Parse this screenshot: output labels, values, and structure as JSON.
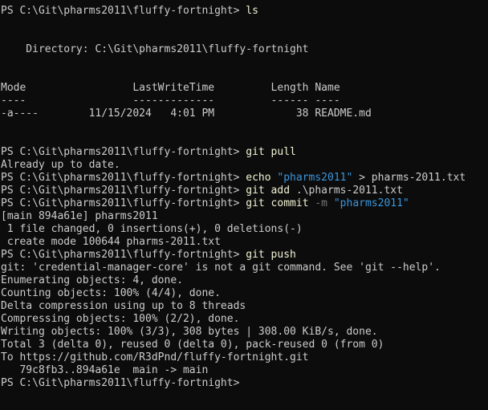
{
  "terminal": {
    "lines": [
      {
        "segments": [
          {
            "text": "PS C:\\Git\\pharms2011\\fluffy-fortnight> ",
            "class": "plain"
          },
          {
            "text": "ls",
            "class": "cmd"
          }
        ]
      },
      {
        "segments": []
      },
      {
        "segments": []
      },
      {
        "segments": [
          {
            "text": "    Directory: C:\\Git\\pharms2011\\fluffy-fortnight",
            "class": "plain"
          }
        ]
      },
      {
        "segments": []
      },
      {
        "segments": []
      },
      {
        "segments": [
          {
            "text": "Mode                 LastWriteTime         Length Name",
            "class": "plain"
          }
        ]
      },
      {
        "segments": [
          {
            "text": "----                 -------------         ------ ----",
            "class": "plain"
          }
        ]
      },
      {
        "segments": [
          {
            "text": "-a----        11/15/2024   4:01 PM             38 README.md",
            "class": "plain"
          }
        ]
      },
      {
        "segments": []
      },
      {
        "segments": []
      },
      {
        "segments": [
          {
            "text": "PS C:\\Git\\pharms2011\\fluffy-fortnight> ",
            "class": "plain"
          },
          {
            "text": "git pull",
            "class": "cmd"
          }
        ]
      },
      {
        "segments": [
          {
            "text": "Already up to date.",
            "class": "plain"
          }
        ]
      },
      {
        "segments": [
          {
            "text": "PS C:\\Git\\pharms2011\\fluffy-fortnight> ",
            "class": "plain"
          },
          {
            "text": "echo ",
            "class": "cmd"
          },
          {
            "text": "\"pharms2011\"",
            "class": "str"
          },
          {
            "text": " > pharms-2011.txt",
            "class": "plain"
          }
        ]
      },
      {
        "segments": [
          {
            "text": "PS C:\\Git\\pharms2011\\fluffy-fortnight> ",
            "class": "plain"
          },
          {
            "text": "git add",
            "class": "cmd"
          },
          {
            "text": " .\\pharms-2011.txt",
            "class": "plain"
          }
        ]
      },
      {
        "segments": [
          {
            "text": "PS C:\\Git\\pharms2011\\fluffy-fortnight> ",
            "class": "plain"
          },
          {
            "text": "git commit",
            "class": "cmd"
          },
          {
            "text": " -m ",
            "class": "flag"
          },
          {
            "text": "\"pharms2011\"",
            "class": "str"
          }
        ]
      },
      {
        "segments": [
          {
            "text": "[main 894a61e] pharms2011",
            "class": "plain"
          }
        ]
      },
      {
        "segments": [
          {
            "text": " 1 file changed, 0 insertions(+), 0 deletions(-)",
            "class": "plain"
          }
        ]
      },
      {
        "segments": [
          {
            "text": " create mode 100644 pharms-2011.txt",
            "class": "plain"
          }
        ]
      },
      {
        "segments": [
          {
            "text": "PS C:\\Git\\pharms2011\\fluffy-fortnight> ",
            "class": "plain"
          },
          {
            "text": "git push",
            "class": "cmd"
          }
        ]
      },
      {
        "segments": [
          {
            "text": "git: 'credential-manager-core' is not a git command. See 'git --help'.",
            "class": "plain"
          }
        ]
      },
      {
        "segments": [
          {
            "text": "Enumerating objects: 4, done.",
            "class": "plain"
          }
        ]
      },
      {
        "segments": [
          {
            "text": "Counting objects: 100% (4/4), done.",
            "class": "plain"
          }
        ]
      },
      {
        "segments": [
          {
            "text": "Delta compression using up to 8 threads",
            "class": "plain"
          }
        ]
      },
      {
        "segments": [
          {
            "text": "Compressing objects: 100% (2/2), done.",
            "class": "plain"
          }
        ]
      },
      {
        "segments": [
          {
            "text": "Writing objects: 100% (3/3), 308 bytes | 308.00 KiB/s, done.",
            "class": "plain"
          }
        ]
      },
      {
        "segments": [
          {
            "text": "Total 3 (delta 0), reused 0 (delta 0), pack-reused 0 (from 0)",
            "class": "plain"
          }
        ]
      },
      {
        "segments": [
          {
            "text": "To https://github.com/R3dPnd/fluffy-fortnight.git",
            "class": "plain"
          }
        ]
      },
      {
        "segments": [
          {
            "text": "   79c8fb3..894a61e  main -> main",
            "class": "plain"
          }
        ]
      },
      {
        "segments": [
          {
            "text": "PS C:\\Git\\pharms2011\\fluffy-fortnight> ",
            "class": "plain"
          }
        ]
      }
    ]
  }
}
